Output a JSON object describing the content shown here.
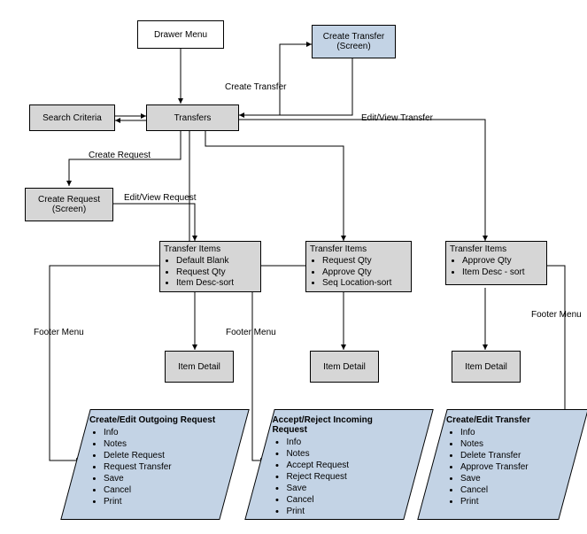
{
  "nodes": {
    "drawerMenu": "Drawer Menu",
    "createTransferScreen": "Create Transfer (Screen)",
    "searchCriteria": "Search Criteria",
    "transfers": "Transfers",
    "createRequestScreen": "Create Request (Screen)",
    "itemDetail1": "Item Detail",
    "itemDetail2": "Item Detail",
    "itemDetail3": "Item Detail"
  },
  "transferItems": {
    "col1": {
      "title": "Transfer Items",
      "items": [
        "Default Blank",
        "Request Qty",
        "Item Desc-sort"
      ]
    },
    "col2": {
      "title": "Transfer Items",
      "items": [
        "Request Qty",
        "Approve Qty",
        "Seq Location-sort"
      ]
    },
    "col3": {
      "title": "Transfer Items",
      "items": [
        "Approve Qty",
        "Item Desc - sort"
      ]
    }
  },
  "footers": {
    "p1": {
      "title": "Create/Edit Outgoing Request",
      "items": [
        "Info",
        "Notes",
        "Delete Request",
        "Request Transfer",
        "Save",
        "Cancel",
        "Print"
      ]
    },
    "p2": {
      "title": "Accept/Reject Incoming Request",
      "items": [
        "Info",
        "Notes",
        "Accept Request",
        "Reject Request",
        "Save",
        "Cancel",
        "Print"
      ]
    },
    "p3": {
      "title": "Create/Edit Transfer",
      "items": [
        "Info",
        "Notes",
        "Delete Transfer",
        "Approve Transfer",
        "Save",
        "Cancel",
        "Print"
      ]
    }
  },
  "edges": {
    "createTransfer": "Create Transfer",
    "editViewTransfer": "Edit/View Transfer",
    "createRequest": "Create Request",
    "editViewRequest": "Edit/View Request",
    "footerMenu1": "Footer Menu",
    "footerMenu2": "Footer Menu",
    "footerMenu3": "Footer Menu"
  }
}
